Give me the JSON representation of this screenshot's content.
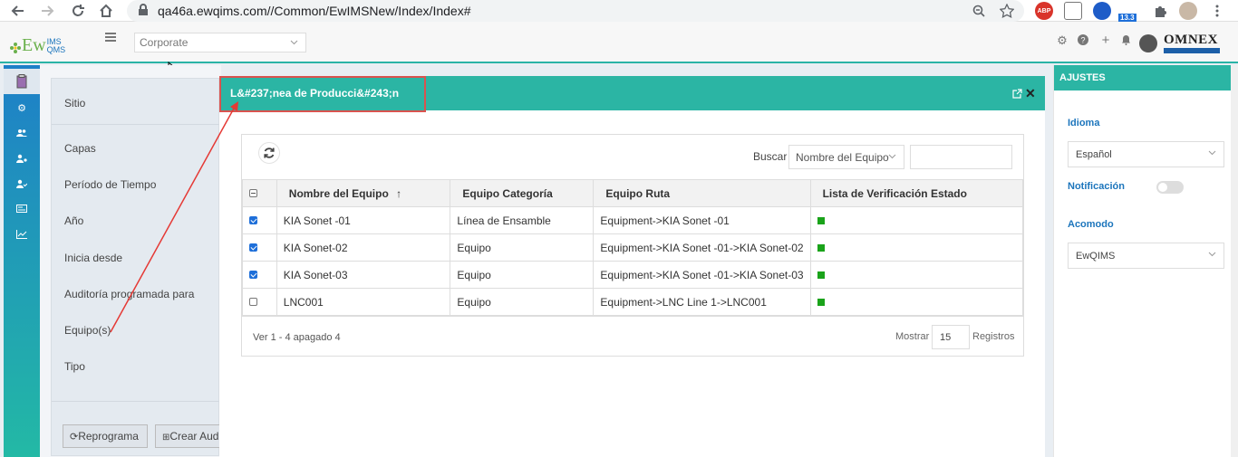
{
  "browser": {
    "url": "qa46a.ewqims.com//Common/EwIMSNew/Index/Index#",
    "extension_badge": "13.3",
    "abp_label": "ABP"
  },
  "app": {
    "logo_text": "Ew",
    "logo_superscript_top": "IMS",
    "logo_superscript_bottom": "QMS",
    "corporate_select": "Corporate",
    "brand": "OMNEX"
  },
  "filter_panel": {
    "labels": [
      "Sitio",
      "Capas",
      "Período de Tiempo",
      "Año",
      "Inicia desde",
      "Auditoría programada para",
      "Equipo(s)",
      "Tipo"
    ],
    "reschedule_button": "Reprograma",
    "create_button": "Crear Auditoría"
  },
  "modal": {
    "title": "L&#237;nea de Producci&#243;n",
    "search_label": "Buscar",
    "search_field_select": "Nombre del Equipo",
    "search_value": "",
    "columns": [
      "Nombre del Equipo",
      "Equipo Categoría",
      "Equipo Ruta",
      "Lista de Verificación Estado"
    ],
    "rows": [
      {
        "checked": true,
        "name": "KIA Sonet -01",
        "category": "Línea de Ensamble",
        "route": "Equipment->KIA Sonet -01",
        "status_color": "#1aa31a"
      },
      {
        "checked": true,
        "name": "KIA Sonet-02",
        "category": "Equipo",
        "route": "Equipment->KIA Sonet -01->KIA Sonet-02",
        "status_color": "#1aa31a"
      },
      {
        "checked": true,
        "name": "KIA Sonet-03",
        "category": "Equipo",
        "route": "Equipment->KIA Sonet -01->KIA Sonet-03",
        "status_color": "#1aa31a"
      },
      {
        "checked": false,
        "name": "LNC001",
        "category": "Equipo",
        "route": "Equipment->LNC Line 1->LNC001",
        "status_color": "#1aa31a"
      }
    ],
    "records_summary": "Ver 1 - 4 apagado 4",
    "show_label": "Mostrar",
    "page_size": "15",
    "records_label": "Registros"
  },
  "settings": {
    "header": "AJUSTES",
    "language_label": "Idioma",
    "language_value": "Español",
    "notification_label": "Notificación",
    "notification_on": false,
    "layout_label": "Acomodo",
    "layout_value": "EwQIMS"
  },
  "colors": {
    "accent": "#2bb5a4",
    "annotation": "#d9534f",
    "label_blue": "#1c75bc"
  }
}
